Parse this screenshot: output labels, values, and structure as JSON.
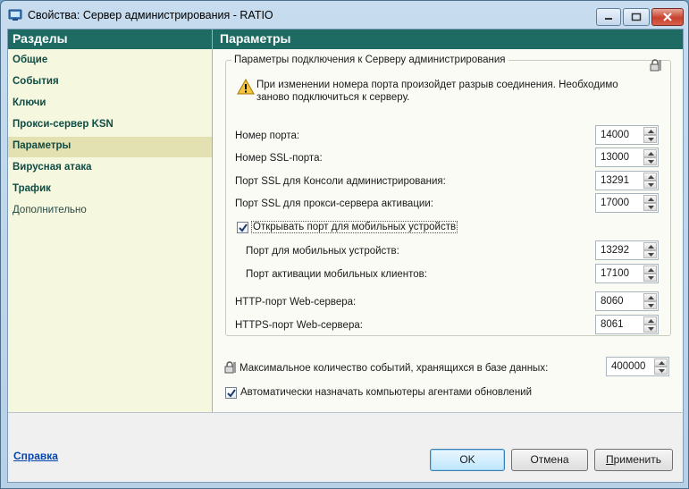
{
  "window": {
    "title": "Свойства: Сервер администрирования - RATIO"
  },
  "sidebar": {
    "header": "Разделы",
    "items": [
      {
        "label": "Общие"
      },
      {
        "label": "События"
      },
      {
        "label": "Ключи"
      },
      {
        "label": "Прокси-сервер KSN"
      },
      {
        "label": "Параметры",
        "active": true
      },
      {
        "label": "Вирусная атака"
      },
      {
        "label": "Трафик"
      },
      {
        "label": "Дополнительно"
      }
    ]
  },
  "main": {
    "header": "Параметры",
    "group_title": "Параметры подключения к Серверу администрирования",
    "warning": "При изменении номера порта произойдет разрыв соединения. Необходимо заново подключиться к серверу.",
    "ports": [
      {
        "label": "Номер порта:",
        "value": "14000"
      },
      {
        "label": "Номер SSL-порта:",
        "value": "13000"
      },
      {
        "label": "Порт SSL для Консоли администрирования:",
        "value": "13291"
      },
      {
        "label": "Порт SSL для прокси-сервера активации:",
        "value": "17000"
      }
    ],
    "mobile_checkbox": {
      "label": "Открывать порт для мобильных устройств",
      "checked": true
    },
    "mobile_ports": [
      {
        "label": "Порт для мобильных устройств:",
        "value": "13292"
      },
      {
        "label": "Порт активации мобильных клиентов:",
        "value": "17100"
      }
    ],
    "web_ports": [
      {
        "label": "HTTP-порт Web-сервера:",
        "value": "8060"
      },
      {
        "label": "HTTPS-порт Web-сервера:",
        "value": "8061"
      }
    ],
    "max_events": {
      "label": "Максимальное количество событий, хранящихся в базе данных:",
      "value": "400000"
    },
    "auto_assign": {
      "label": "Автоматически назначать компьютеры агентами обновлений",
      "checked": true
    }
  },
  "footer": {
    "help": "Справка",
    "ok": "OK",
    "cancel": "Отмена",
    "apply": "Применить"
  },
  "colors": {
    "accent": "#1d6b62",
    "sidebar_bg": "#f5f7df",
    "active_item": "#e3e0b2"
  }
}
